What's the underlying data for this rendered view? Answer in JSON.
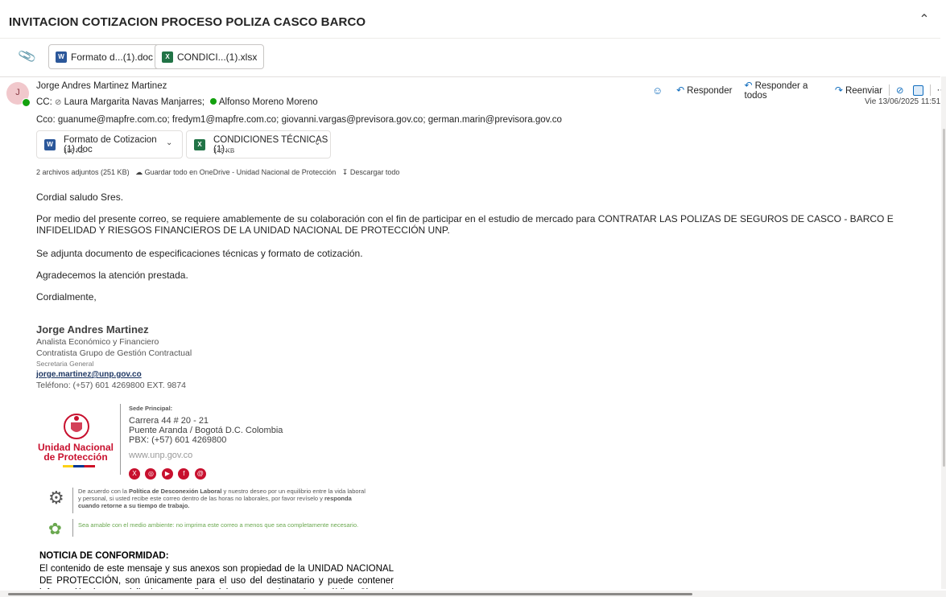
{
  "subject": "INVITACION COTIZACION PROCESO POLIZA CASCO BARCO",
  "top_attachments": [
    {
      "name": "Formato d...(1).doc",
      "type": "word"
    },
    {
      "name": "CONDICI...(1).xlsx",
      "type": "excel"
    }
  ],
  "sender": {
    "initial": "J",
    "name": "Jorge Andres Martinez Martinez",
    "cc_label": "CC:",
    "cc": [
      "Laura Margarita Navas Manjarres;",
      "Alfonso Moreno Moreno"
    ],
    "cco": "Cco: guanume@mapfre.com.co; fredym1@mapfre.com.co; giovanni.vargas@previsora.gov.co; german.marin@previsora.gov.co",
    "date": "Vie 13/06/2025 11:51"
  },
  "actions": {
    "reply": "Responder",
    "reply_all": "Responder a todos",
    "forward": "Reenviar",
    "more": "···"
  },
  "attachments": [
    {
      "name": "Formato de Cotizacion (1).doc",
      "size": "106 KB",
      "type": "word"
    },
    {
      "name": "CONDICIONES TÉCNICAS (1)....",
      "size": "145 KB",
      "type": "excel"
    }
  ],
  "attach_summary": "2 archivos adjuntos (251 KB)",
  "save_onedrive": "Guardar todo en OneDrive - Unidad Nacional de Protección",
  "download_all": "Descargar todo",
  "body": {
    "greeting": "Cordial saludo Sres.",
    "p1": "Por medio del presente correo, se requiere amablemente de su colaboración con el fin de participar en el estudio de mercado para CONTRATAR LAS POLIZAS DE SEGUROS DE CASCO - BARCO E INFIDELIDAD Y RIESGOS FINANCIEROS DE LA UNIDAD NACIONAL DE PROTECCIÓN UNP.",
    "p2": "Se adjunta documento de especificaciones técnicas y formato de cotización.",
    "p3": "Agradecemos la atención prestada.",
    "closing": "Cordialmente,"
  },
  "signature": {
    "name": "Jorge Andres Martinez",
    "role1": "Analista Económico y Financiero",
    "role2": "Contratista Grupo de Gestión Contractual",
    "dept": "Secretaria General",
    "email": "jorge.martinez@unp.gov.co",
    "phone": "Teléfono: (+57) 601 4269800 EXT. 9874",
    "sede_label": "Sede Principal:",
    "address1": "Carrera 44 # 20 - 21",
    "address2": "Puente Aranda / Bogotá D.C. Colombia",
    "pbx": "PBX: (+57) 601 4269800",
    "web": "www.unp.gov.co",
    "logo_line1": "Unidad Nacional",
    "logo_line2": "de Protección",
    "disconnect_a": "De acuerdo con la ",
    "disconnect_b": "Política de Desconexión Laboral",
    "disconnect_c": " y nuestro deseo por un equilibrio entre la vida laboral y personal, si usted recibe este correo dentro de las horas no laborales, por favor revíselo y ",
    "disconnect_d": "responda cuando retorne a su tiempo de trabajo.",
    "eco": "Sea amable con el medio ambiente: no imprima este correo a menos que sea completamente necesario."
  },
  "notice": {
    "title": "NOTICIA DE CONFORMIDAD:",
    "text": "El contenido de este mensaje y sus anexos son propiedad de la UNIDAD NACIONAL DE PROTECCIÓN, son únicamente para el uso del destinatario y puede contener información de uso privilegiado o confidencial que no es de carácter público. Si usted no es el destinatario"
  },
  "colors": {
    "accent": "#0f6cbd",
    "presence": "#13a10e",
    "brand_red": "#c8102e",
    "eco_green": "#6aa84f"
  }
}
